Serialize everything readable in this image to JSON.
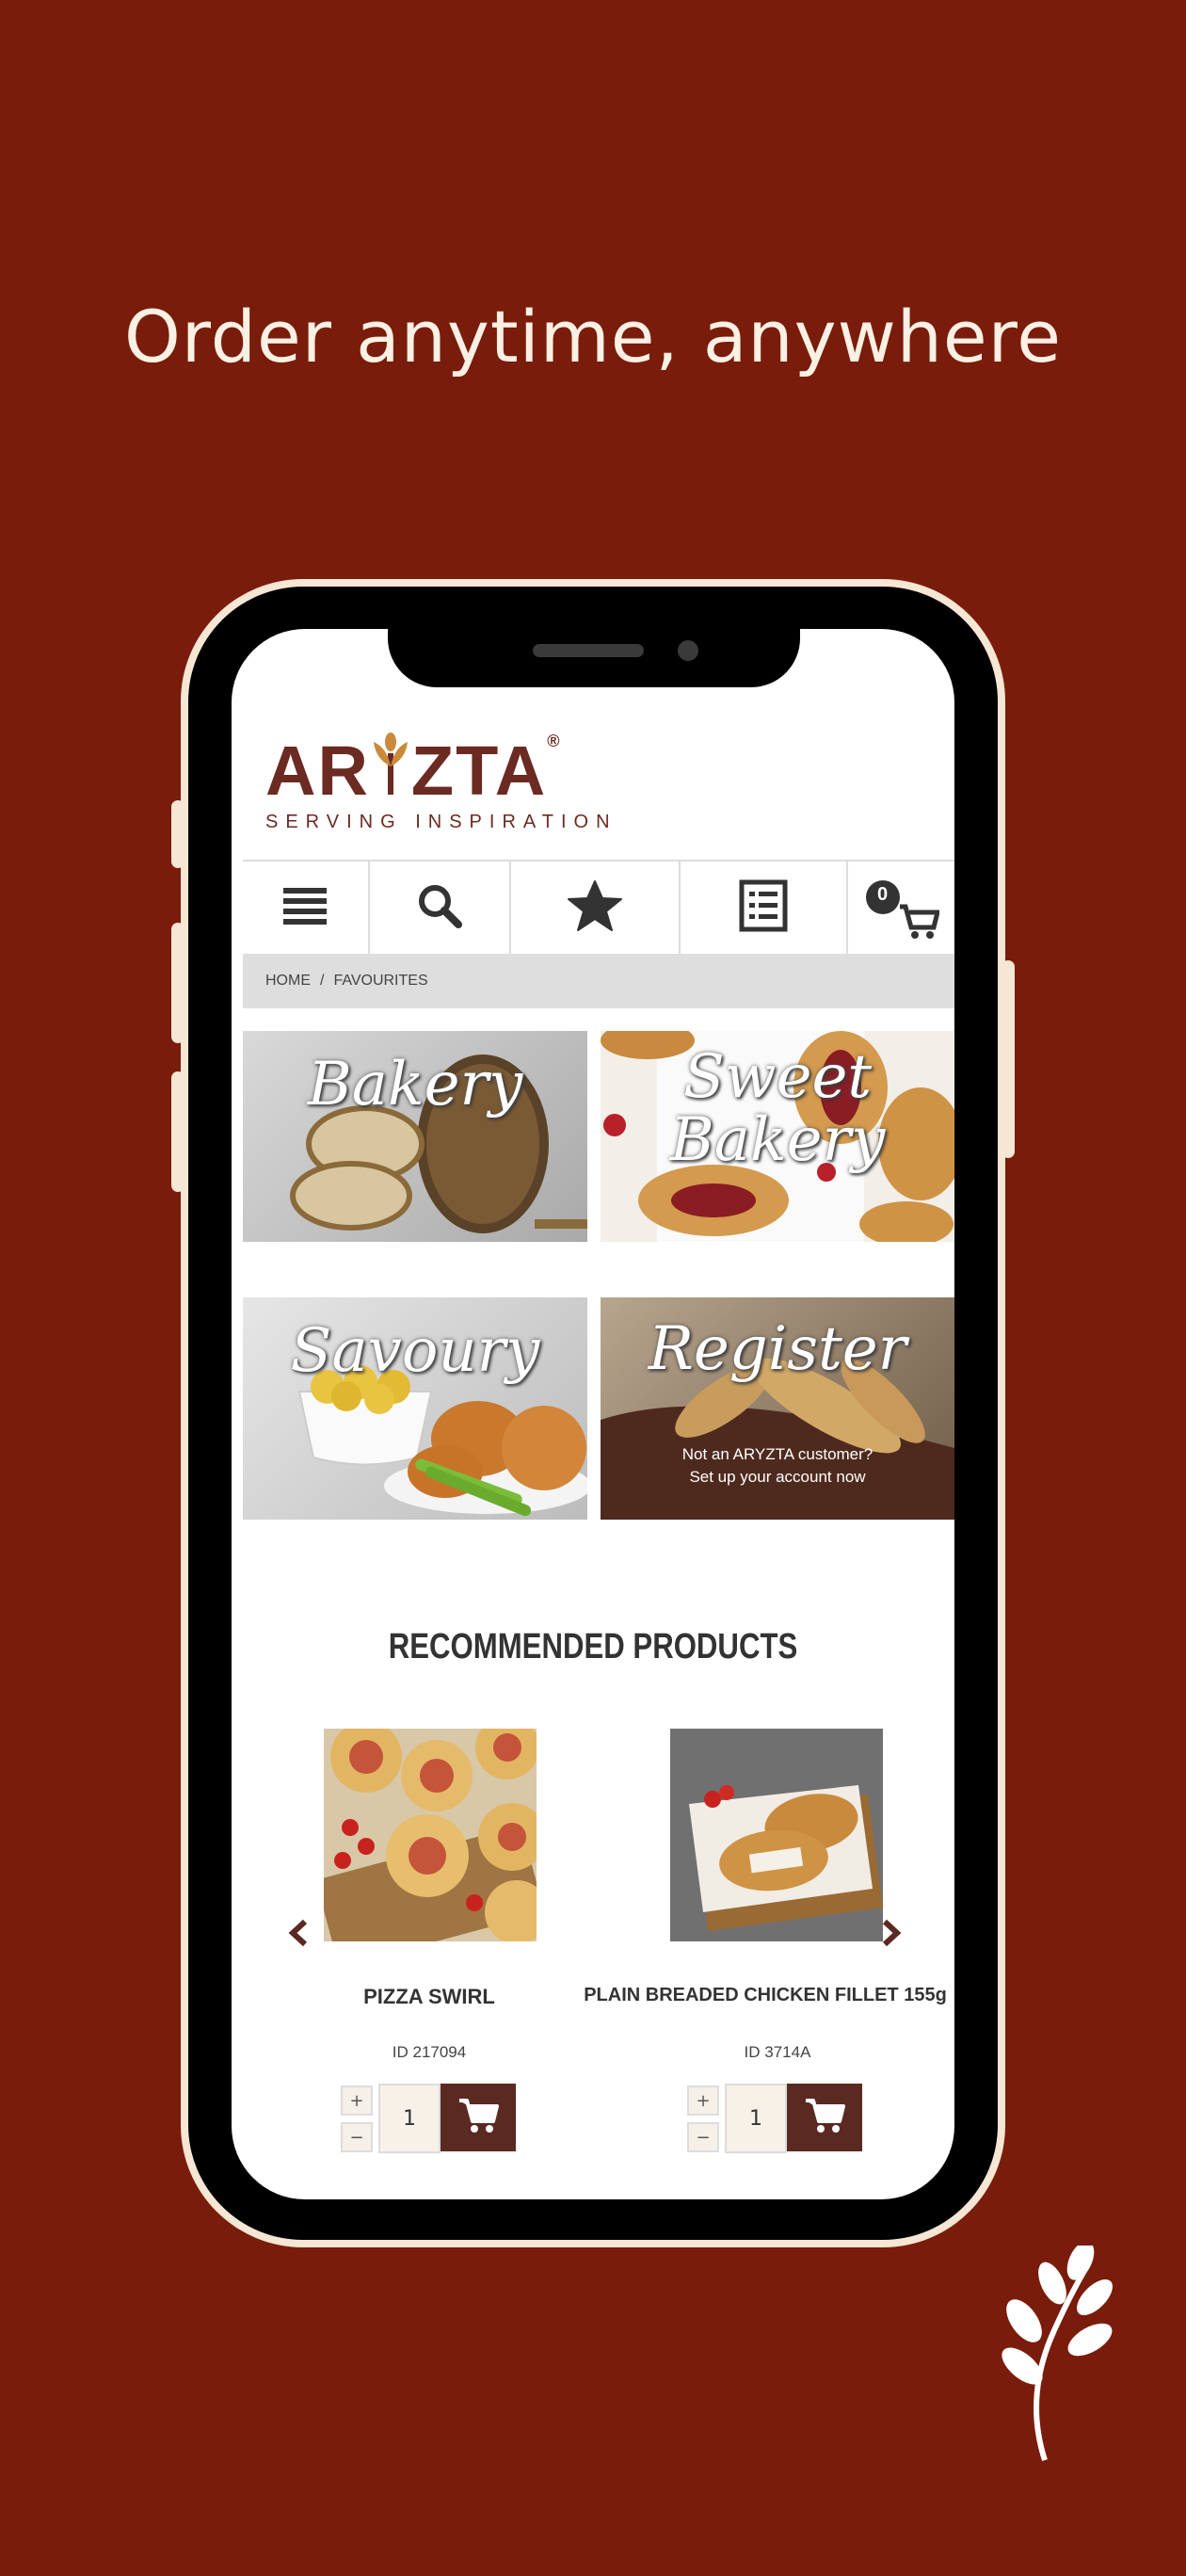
{
  "headline": "Order anytime, anywhere",
  "brand": {
    "name_left": "AR",
    "name_right": "ZTA",
    "registered": "®",
    "tagline": "SERVING INSPIRATION",
    "color": "#6b2a22"
  },
  "toolbar": {
    "items": [
      {
        "icon": "menu-icon"
      },
      {
        "icon": "search-icon"
      },
      {
        "icon": "star-icon"
      },
      {
        "icon": "list-icon"
      },
      {
        "icon": "cart-icon",
        "badge": "0"
      }
    ]
  },
  "breadcrumb": {
    "home": "HOME",
    "separator": "/",
    "current": "FAVOURITES"
  },
  "categories": [
    {
      "title": "Bakery"
    },
    {
      "title_line1": "Sweet",
      "title_line2": "Bakery"
    },
    {
      "title": "Savoury"
    },
    {
      "title": "Register",
      "sub_line1": "Not an ARYZTA customer?",
      "sub_line2": "Set up your account now"
    }
  ],
  "recommended": {
    "title": "RECOMMENDED PRODUCTS",
    "products": [
      {
        "name": "PIZZA SWIRL",
        "id": "ID 217094",
        "qty": "1"
      },
      {
        "name": "PLAIN BREADED CHICKEN FILLET 155g",
        "id": "ID 3714A",
        "qty": "1"
      }
    ],
    "plus": "+",
    "minus": "−"
  },
  "colors": {
    "background": "#7a1c0b",
    "accent": "#5a2a22",
    "frame": "#f6e6d4"
  }
}
